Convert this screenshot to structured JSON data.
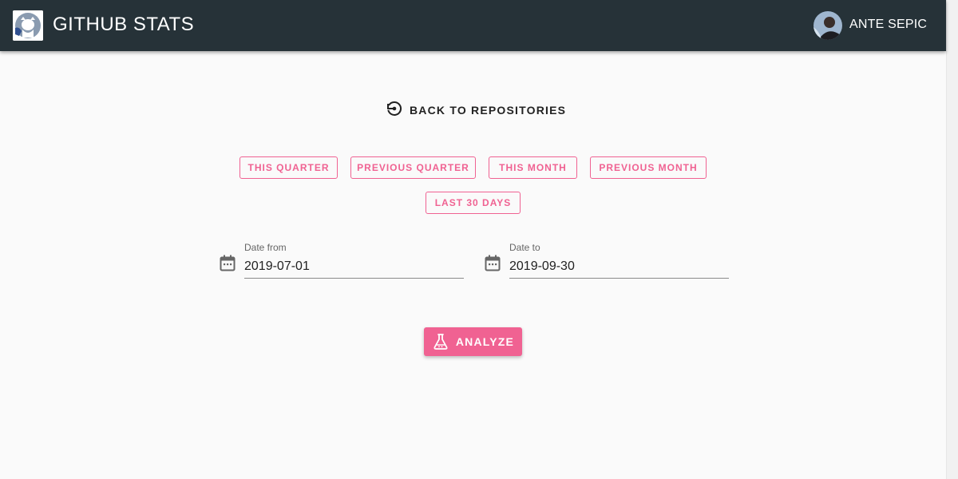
{
  "header": {
    "title": "GITHUB STATS",
    "logo_icon": "github-octocat-icon",
    "user_name": "ANTE SEPIC",
    "avatar_icon": "user-avatar",
    "background": "#263238"
  },
  "back_link": {
    "label": "BACK TO REPOSITORIES",
    "icon": "history-back-icon"
  },
  "range_buttons": [
    {
      "label": "THIS QUARTER"
    },
    {
      "label": "PREVIOUS QUARTER"
    },
    {
      "label": "THIS MONTH"
    },
    {
      "label": "PREVIOUS MONTH"
    },
    {
      "label": "LAST 30 DAYS"
    }
  ],
  "date_from": {
    "label": "Date from",
    "value": "2019-07-01",
    "icon": "calendar-icon"
  },
  "date_to": {
    "label": "Date to",
    "value": "2019-09-30",
    "icon": "calendar-icon"
  },
  "analyze": {
    "label": "ANALYZE",
    "icon": "flask-icon"
  },
  "colors": {
    "accent": "#f06292",
    "page_background": "#fafafa"
  }
}
